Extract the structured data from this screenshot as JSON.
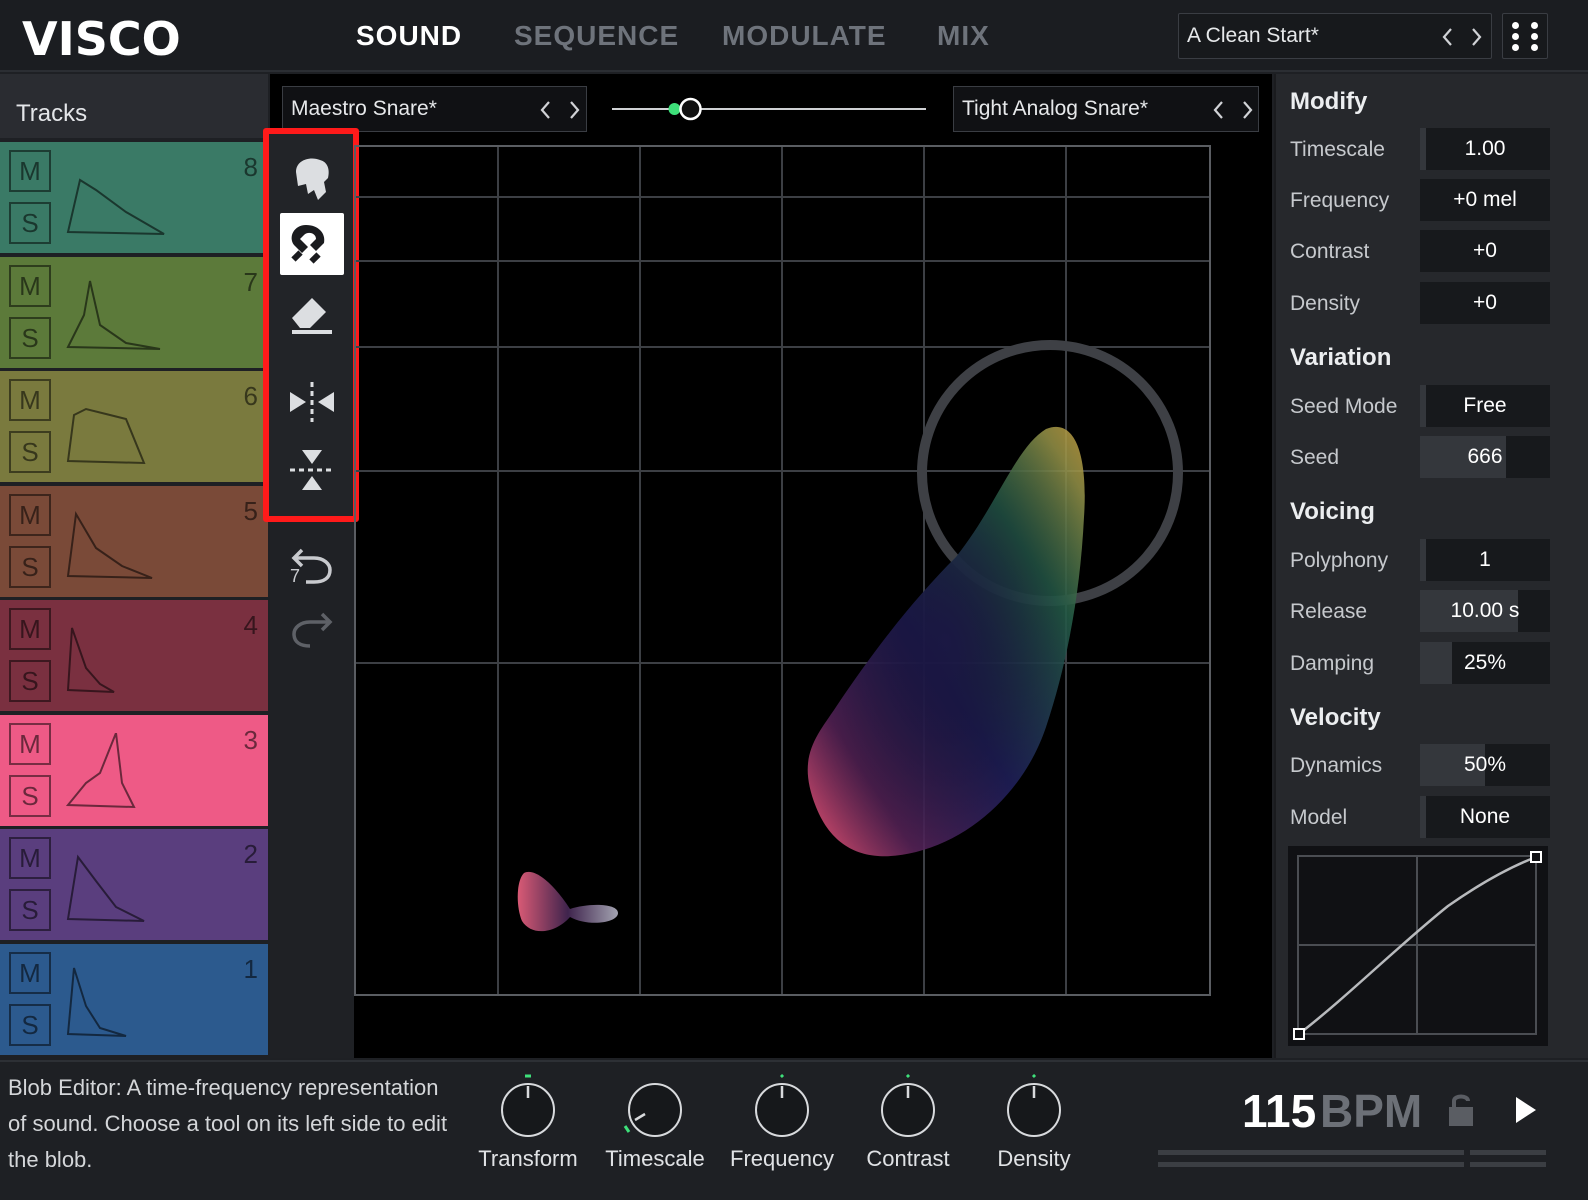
{
  "app": {
    "logo": "VISCO"
  },
  "tabs": [
    {
      "label": "SOUND",
      "active": true
    },
    {
      "label": "SEQUENCE",
      "active": false
    },
    {
      "label": "MODULATE",
      "active": false
    },
    {
      "label": "MIX",
      "active": false
    }
  ],
  "preset": {
    "name": "A Clean Start*"
  },
  "tracks": {
    "title": "Tracks",
    "mute_label": "M",
    "solo_label": "S",
    "items": [
      {
        "number": "8",
        "color": "#3a7a66"
      },
      {
        "number": "7",
        "color": "#5c7a3a"
      },
      {
        "number": "6",
        "color": "#7a7a3e"
      },
      {
        "number": "5",
        "color": "#7a4a38"
      },
      {
        "number": "4",
        "color": "#7a3040"
      },
      {
        "number": "3",
        "color": "#ee5a86"
      },
      {
        "number": "2",
        "color": "#5a3e7e"
      },
      {
        "number": "1",
        "color": "#2c5a8e"
      }
    ]
  },
  "editor": {
    "sound_a": "Maestro Snare*",
    "sound_b": "Tight Analog Snare*",
    "morph_value": 0.25,
    "undo_count": "7",
    "tools": [
      "grab-icon",
      "magnet-icon",
      "eraser-icon",
      "flip-horizontal-icon",
      "flip-vertical-icon"
    ]
  },
  "panel": {
    "modify": {
      "title": "Modify",
      "params": [
        {
          "label": "Timescale",
          "value": "1.00"
        },
        {
          "label": "Frequency",
          "value": "+0 mel"
        },
        {
          "label": "Contrast",
          "value": "+0"
        },
        {
          "label": "Density",
          "value": "+0"
        }
      ]
    },
    "variation": {
      "title": "Variation",
      "params": [
        {
          "label": "Seed Mode",
          "value": "Free"
        },
        {
          "label": "Seed",
          "value": "666"
        }
      ]
    },
    "voicing": {
      "title": "Voicing",
      "params": [
        {
          "label": "Polyphony",
          "value": "1"
        },
        {
          "label": "Release",
          "value": "10.00 s"
        },
        {
          "label": "Damping",
          "value": "25%"
        }
      ]
    },
    "velocity": {
      "title": "Velocity",
      "params": [
        {
          "label": "Dynamics",
          "value": "50%"
        },
        {
          "label": "Model",
          "value": "None"
        }
      ]
    }
  },
  "bottom": {
    "help_text": "Blob Editor: A time-frequency representation of sound. Choose a tool on its left side to edit the blob.",
    "knobs": [
      {
        "label": "Transform"
      },
      {
        "label": "Timescale"
      },
      {
        "label": "Frequency"
      },
      {
        "label": "Contrast"
      },
      {
        "label": "Density"
      }
    ],
    "bpm_value": "115",
    "bpm_unit": "BPM"
  }
}
